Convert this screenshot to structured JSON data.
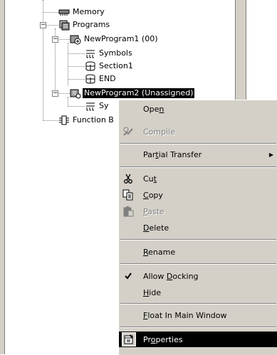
{
  "tree": {
    "memory": "Memory",
    "programs": "Programs",
    "program1": "NewProgram1 (00)",
    "symbols": "Symbols",
    "section1": "Section1",
    "end": "END",
    "program2": "NewProgram2 (Unassigned)",
    "symbols2_partial": "Sy",
    "function_blocks_partial": "Function B"
  },
  "menu": {
    "open": {
      "pre": "Ope",
      "key": "n",
      "post": ""
    },
    "compile": "Compile",
    "partial_transfer": {
      "pre": "Par",
      "key": "t",
      "post": "ial Transfer"
    },
    "cut": {
      "pre": "Cu",
      "key": "t",
      "post": ""
    },
    "copy": {
      "pre": "",
      "key": "C",
      "post": "opy"
    },
    "paste": {
      "pre": "",
      "key": "P",
      "post": "aste"
    },
    "delete": {
      "pre": "",
      "key": "D",
      "post": "elete"
    },
    "rename": {
      "pre": "",
      "key": "R",
      "post": "ename"
    },
    "allow_docking": {
      "pre": "Allow ",
      "key": "D",
      "post": "ocking"
    },
    "hide": {
      "pre": "",
      "key": "H",
      "post": "ide"
    },
    "float": {
      "pre": "",
      "key": "F",
      "post": "loat In Main Window"
    },
    "properties": {
      "pre": "Pr",
      "key": "o",
      "post": "perties"
    }
  }
}
